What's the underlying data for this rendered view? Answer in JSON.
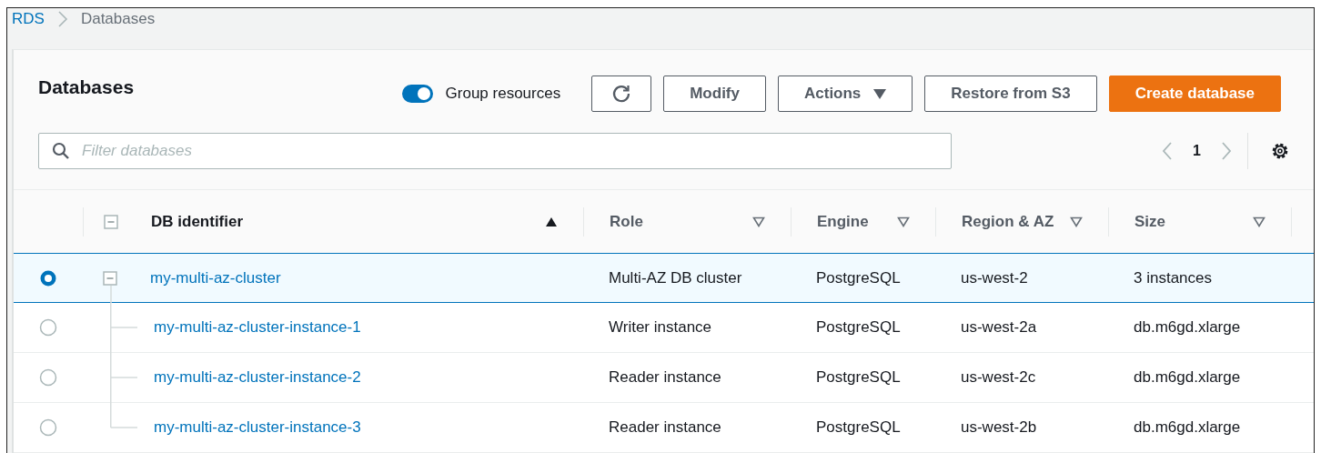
{
  "breadcrumb": [
    {
      "label": "RDS",
      "kind": "link"
    },
    {
      "label": "Databases",
      "kind": "current"
    }
  ],
  "header": {
    "title": "Databases",
    "group_toggle": {
      "label": "Group resources",
      "on": true
    },
    "buttons": [
      {
        "kind": "refresh"
      },
      {
        "kind": "normal",
        "label": "Modify"
      },
      {
        "kind": "dropdown",
        "label": "Actions"
      },
      {
        "kind": "normal",
        "label": "Restore from S3"
      },
      {
        "kind": "primary",
        "label": "Create database"
      }
    ]
  },
  "filter": {
    "placeholder": "Filter databases"
  },
  "pagination": {
    "page": "1"
  },
  "table": {
    "columns": [
      {
        "label": "DB identifier",
        "sorted": true
      },
      {
        "label": "Role",
        "sorted": false
      },
      {
        "label": "Engine",
        "sorted": false
      },
      {
        "label": "Region & AZ",
        "sorted": false
      },
      {
        "label": "Size",
        "sorted": false
      }
    ],
    "rows": [
      {
        "identifier": "my-multi-az-cluster",
        "role": "Multi-AZ DB cluster",
        "engine": "PostgreSQL",
        "region": "us-west-2",
        "size": "3 instances",
        "selected": true,
        "expanded": true,
        "children": [
          {
            "identifier": "my-multi-az-cluster-instance-1",
            "role": "Writer instance",
            "engine": "PostgreSQL",
            "region": "us-west-2a",
            "size": "db.m6gd.xlarge",
            "selected": false
          },
          {
            "identifier": "my-multi-az-cluster-instance-2",
            "role": "Reader instance",
            "engine": "PostgreSQL",
            "region": "us-west-2c",
            "size": "db.m6gd.xlarge",
            "selected": false
          },
          {
            "identifier": "my-multi-az-cluster-instance-3",
            "role": "Reader instance",
            "engine": "PostgreSQL",
            "region": "us-west-2b",
            "size": "db.m6gd.xlarge",
            "selected": false
          }
        ]
      }
    ]
  }
}
